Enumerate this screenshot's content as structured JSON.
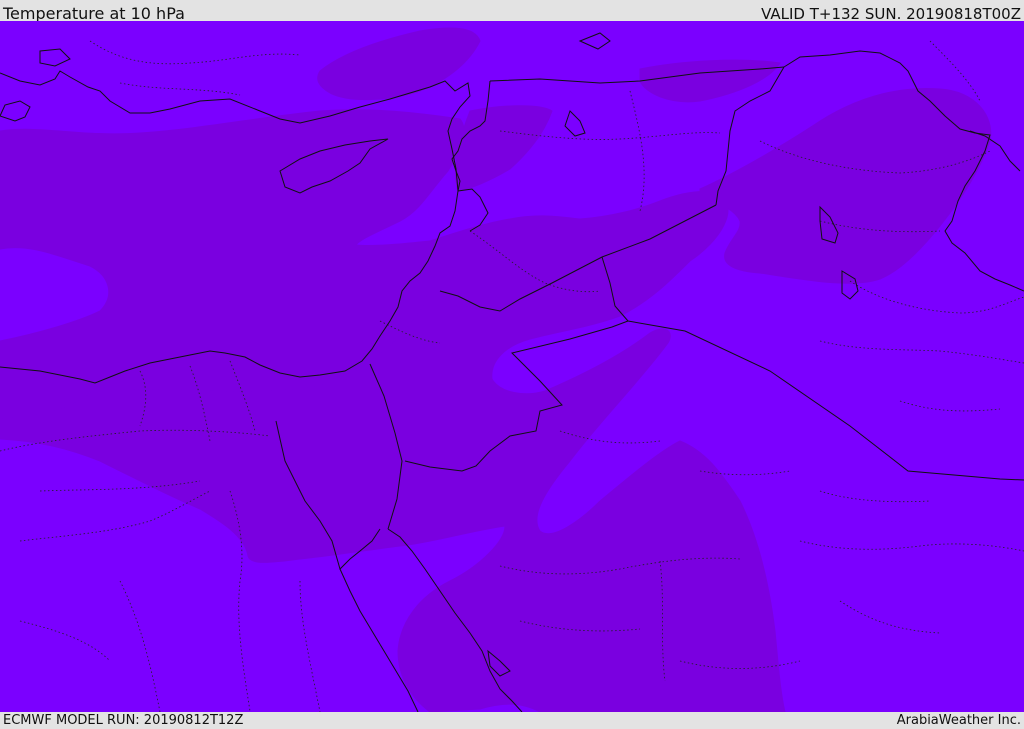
{
  "header": {
    "title": "Temperature at 10 hPa",
    "valid": "VALID T+132 SUN. 20190818T00Z"
  },
  "footer": {
    "model_run": "ECMWF MODEL RUN: 20190812T12Z",
    "credit": "ArabiaWeather Inc."
  },
  "map": {
    "colors": {
      "fill_light": "#7b00ff",
      "fill_dark": "#7a00e0",
      "coastline": "#111111",
      "borders": "#222222"
    }
  }
}
